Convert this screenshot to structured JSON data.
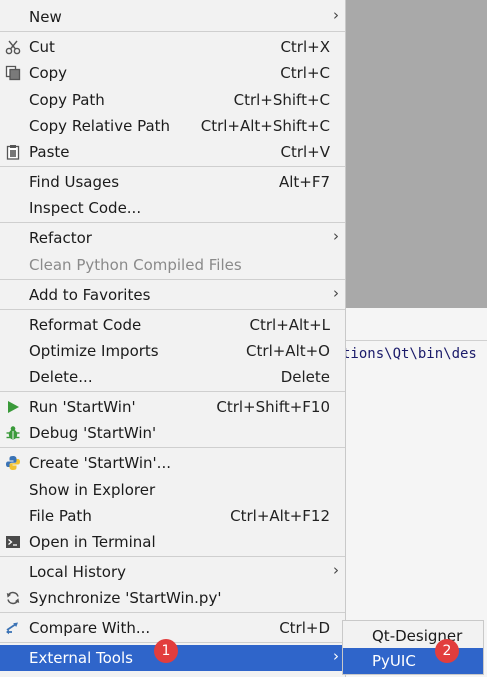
{
  "menu": {
    "new": {
      "label": "New"
    },
    "cut": {
      "label": "Cut",
      "shortcut": "Ctrl+X"
    },
    "copy": {
      "label": "Copy",
      "shortcut": "Ctrl+C"
    },
    "copy_path": {
      "label": "Copy Path",
      "shortcut": "Ctrl+Shift+C"
    },
    "copy_relative_path": {
      "label": "Copy Relative Path",
      "shortcut": "Ctrl+Alt+Shift+C"
    },
    "paste": {
      "label": "Paste",
      "shortcut": "Ctrl+V"
    },
    "find_usages": {
      "label": "Find Usages",
      "shortcut": "Alt+F7"
    },
    "inspect_code": {
      "label": "Inspect Code..."
    },
    "refactor": {
      "label": "Refactor"
    },
    "clean_python": {
      "label": "Clean Python Compiled Files"
    },
    "add_favorites": {
      "label": "Add to Favorites"
    },
    "reformat_code": {
      "label": "Reformat Code",
      "shortcut": "Ctrl+Alt+L"
    },
    "optimize_imports": {
      "label": "Optimize Imports",
      "shortcut": "Ctrl+Alt+O"
    },
    "delete": {
      "label": "Delete...",
      "shortcut": "Delete"
    },
    "run": {
      "label": "Run 'StartWin'",
      "shortcut": "Ctrl+Shift+F10"
    },
    "debug": {
      "label": "Debug 'StartWin'"
    },
    "create": {
      "label": "Create 'StartWin'..."
    },
    "show_explorer": {
      "label": "Show in Explorer"
    },
    "file_path": {
      "label": "File Path",
      "shortcut": "Ctrl+Alt+F12"
    },
    "open_terminal": {
      "label": "Open in Terminal"
    },
    "local_history": {
      "label": "Local History"
    },
    "synchronize": {
      "label": "Synchronize 'StartWin.py'"
    },
    "compare_with": {
      "label": "Compare With...",
      "shortcut": "Ctrl+D"
    },
    "external_tools": {
      "label": "External Tools"
    }
  },
  "submenu": {
    "qt_designer": {
      "label": "Qt-Designer"
    },
    "pyuic": {
      "label": "PyUIC"
    }
  },
  "editor": {
    "path_text": "tions\\Qt\\bin\\des"
  },
  "badges": {
    "one": "1",
    "two": "2"
  },
  "colors": {
    "selection": "#2f65ca",
    "badge": "#e23d3d",
    "menu_bg": "#f2f2f2",
    "disabled_text": "#8a8a8a"
  }
}
